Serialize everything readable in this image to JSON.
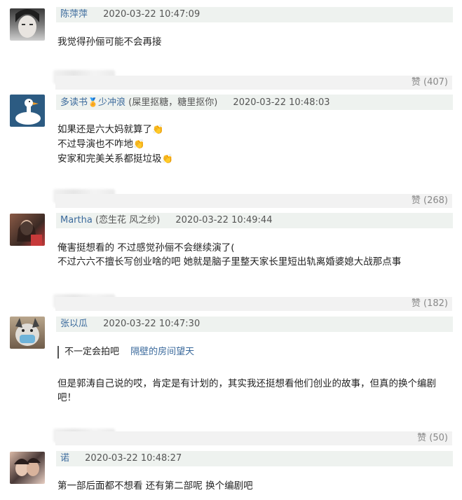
{
  "comments": [
    {
      "user": "陈萍萍",
      "badge": "",
      "time": "2020-03-22 10:47:09",
      "lines": [
        "我觉得孙俪可能不会再接"
      ],
      "likes": "赞 (407)"
    },
    {
      "user": "多读书",
      "badge_user": "少冲浪",
      "badge": "(屎里抠糖，糖里抠你)",
      "time": "2020-03-22 10:48:03",
      "lines": [
        "如果还是六大妈就算了",
        "不过导演也不咋地",
        "安家和完美关系都挺垃圾"
      ],
      "likes": "赞 (268)"
    },
    {
      "user": "Martha",
      "badge": "(恋生花 风之纱)",
      "time": "2020-03-22 10:49:44",
      "lines": [
        "俺害挺想看的 不过感觉孙俪不会继续演了(",
        "不过六六不擅长写创业啥的吧 她就是脑子里整天家长里短出轨离婚婆媳大战那点事"
      ],
      "likes": "赞 (182)"
    },
    {
      "user": "张以瓜",
      "badge": "",
      "time": "2020-03-22 10:47:30",
      "quote_text": "不一定会拍吧",
      "quote_user": "隔壁的房间望天",
      "lines": [
        "但是郭涛自己说的哎，肯定是有计划的，其实我还挺想看他们创业的故事，但真的换个编剧",
        "吧！"
      ],
      "likes": "赞 (50)"
    },
    {
      "user": "诺",
      "badge": "",
      "time": "2020-03-22 10:48:27",
      "lines": [
        "第一部后面都不想看 还有第二部呢 换个编剧吧"
      ]
    }
  ],
  "icons": {
    "clap": "👏",
    "medal": "🏅"
  }
}
